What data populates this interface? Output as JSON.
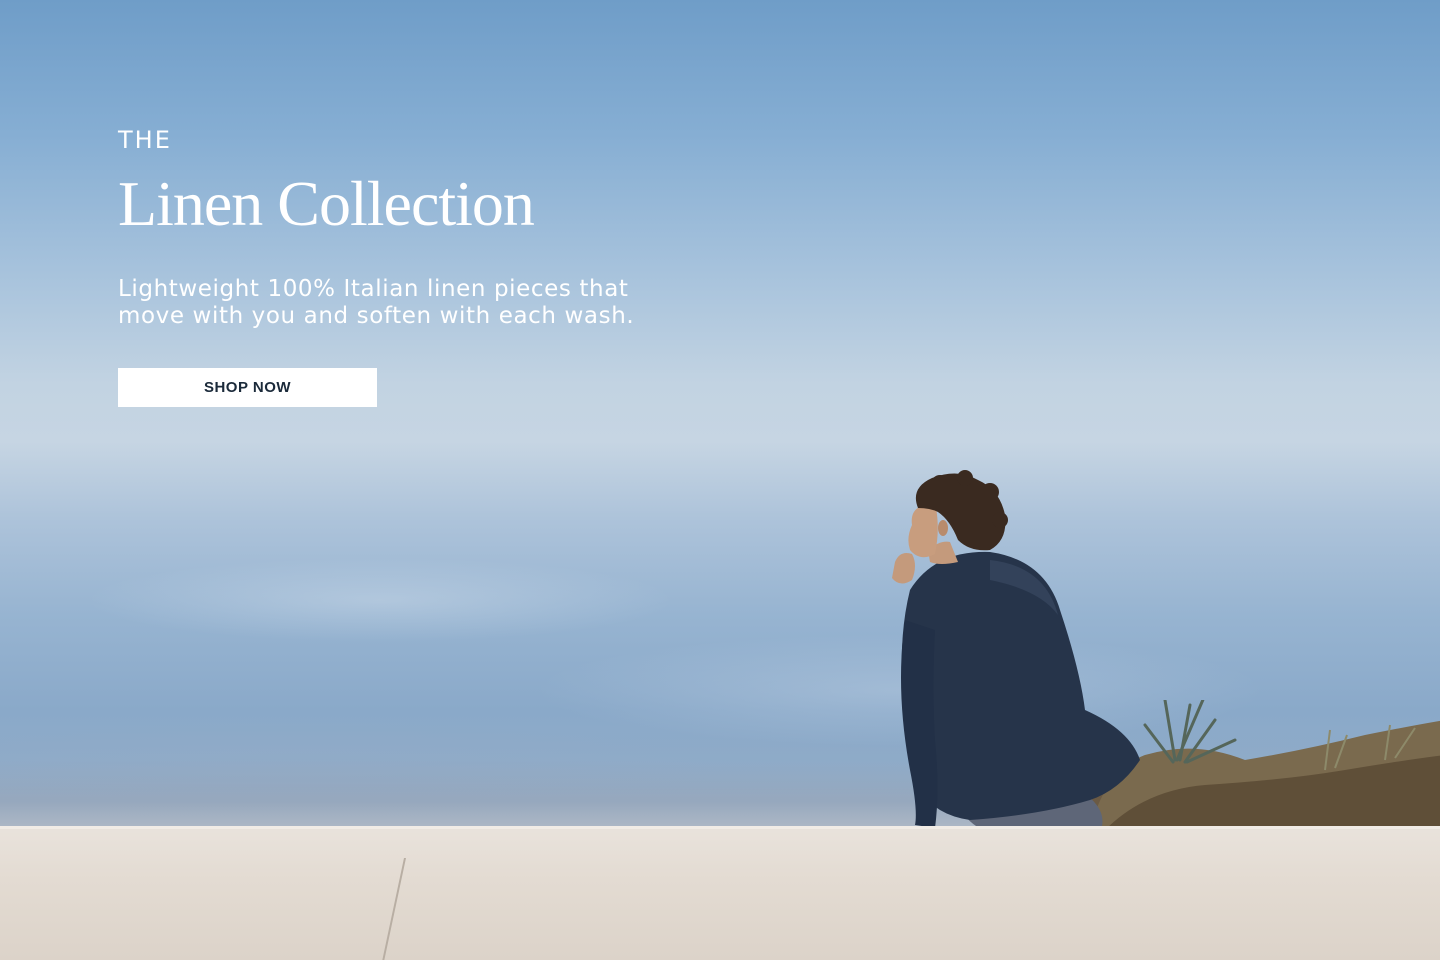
{
  "hero": {
    "eyebrow": "THE",
    "title": "Linen Collection",
    "subtitle_line1": "Lightweight 100% Italian linen pieces that",
    "subtitle_line2": "move with you and soften with each wash.",
    "cta_label": "SHOP NOW",
    "image": "man-in-navy-linen-shirt-sitting-on-terrace-overlooking-sea"
  },
  "colors": {
    "sky_top": "#6f9dc8",
    "cta_bg": "#ffffff",
    "cta_text": "#1b2a3a",
    "text": "#ffffff"
  }
}
